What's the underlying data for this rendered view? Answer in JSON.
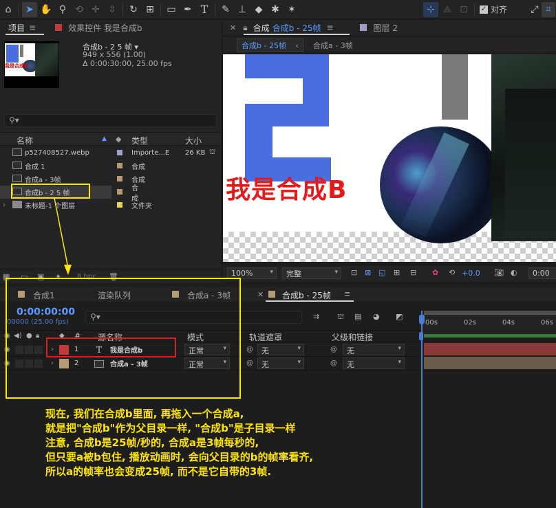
{
  "toolbar": {
    "icons": [
      "home-icon",
      "selection-icon",
      "hand-icon",
      "zoom-icon",
      "orbit-icon",
      "pan-behind-icon",
      "dolly-icon",
      "rotate-icon",
      "anchor-icon",
      "rectangle-icon",
      "pen-icon",
      "type-icon",
      "brush-icon",
      "stamp-icon",
      "eraser-icon",
      "roto-brush-icon",
      "puppet-icon"
    ],
    "snap_label": "对齐"
  },
  "project": {
    "tab_label": "项目",
    "effects_tab_label": "效果控件 我是合成b",
    "preview_name": "合成b - 2 5 帧 ▾",
    "preview_dims": "949 x 556 (1.00)",
    "preview_duration": "Δ 0:00:30:00, 25.00 fps",
    "thumb_text": "我是合成B",
    "search_placeholder": "",
    "columns": {
      "name": "名称",
      "type": "类型",
      "size": "大小"
    },
    "items": [
      {
        "name": "p527408527.webp",
        "type": "Importe...E",
        "size": "26 KB",
        "color": "#9f9fcc",
        "icon": "image-file-icon"
      },
      {
        "name": "合成 1",
        "type": "合成",
        "size": "",
        "color": "#b59a76",
        "icon": "composition-icon"
      },
      {
        "name": "合成a - 3帧",
        "type": "合成",
        "size": "",
        "color": "#b59a76",
        "icon": "composition-icon"
      },
      {
        "name": "合成b - 2 5 帧",
        "type": "合成",
        "size": "",
        "color": "#b59a76",
        "icon": "composition-icon"
      },
      {
        "name": "未标题-1 个图层",
        "type": "文件夹",
        "size": "",
        "color": "#e6d45a",
        "icon": "folder-icon"
      }
    ],
    "bpc_label": "8 bpc"
  },
  "viewer": {
    "tab_label": "合成",
    "tab_comp": "合成b - 25帧",
    "layer_tab": "图层 2",
    "breadcrumb_active": "合成b - 25帧",
    "breadcrumb_next": "合成a - 3帧",
    "comp_text": "我是合成B",
    "zoom": "100%",
    "quality": "完整",
    "exposure": "+0.0",
    "timecode": "0:00"
  },
  "timeline": {
    "tabs": [
      "合成1",
      "渲染队列",
      "合成a - 3帧",
      "合成b - 25帧"
    ],
    "timecode": "0:00:00:00",
    "fps_line": "00000 (25.00 fps)",
    "search_placeholder": "",
    "columns": {
      "num": "#",
      "source_name": "源名称",
      "mode": "模式",
      "track_matte": "轨道遮罩",
      "parent": "父级和链接"
    },
    "layers": [
      {
        "num": "1",
        "type_icon": "T",
        "name": "我是合成b",
        "mode": "正常",
        "matte": "无",
        "parent": "无",
        "color": "#c43a3a"
      },
      {
        "num": "2",
        "type_icon": "comp",
        "name": "合成a - 3帧",
        "mode": "正常",
        "matte": "无",
        "parent": "无",
        "color": "#b59a76"
      }
    ],
    "ruler": [
      "00s",
      "02s",
      "04s",
      "06s"
    ]
  },
  "annotation": {
    "lines": [
      "现在, 我们在合成b里面, 再拖入一个合成a,",
      "就是把\"合成b\"作为父目录一样, \"合成b\"是子目录一样",
      "注意, 合成b是25帧/秒的, 合成a是3帧每秒的,",
      "但只要a被b包住, 播放动画时, 会向父目录的b的帧率看齐,",
      "所以a的帧率也会变成25帧, 而不是它自带的3帧."
    ]
  },
  "colors": {
    "accent": "#5a9cff",
    "highlight": "#ffe600",
    "red_label": "#e02020",
    "timeline_bar_1": "#8b3a3a",
    "timeline_bar_2": "#6a5a48"
  }
}
